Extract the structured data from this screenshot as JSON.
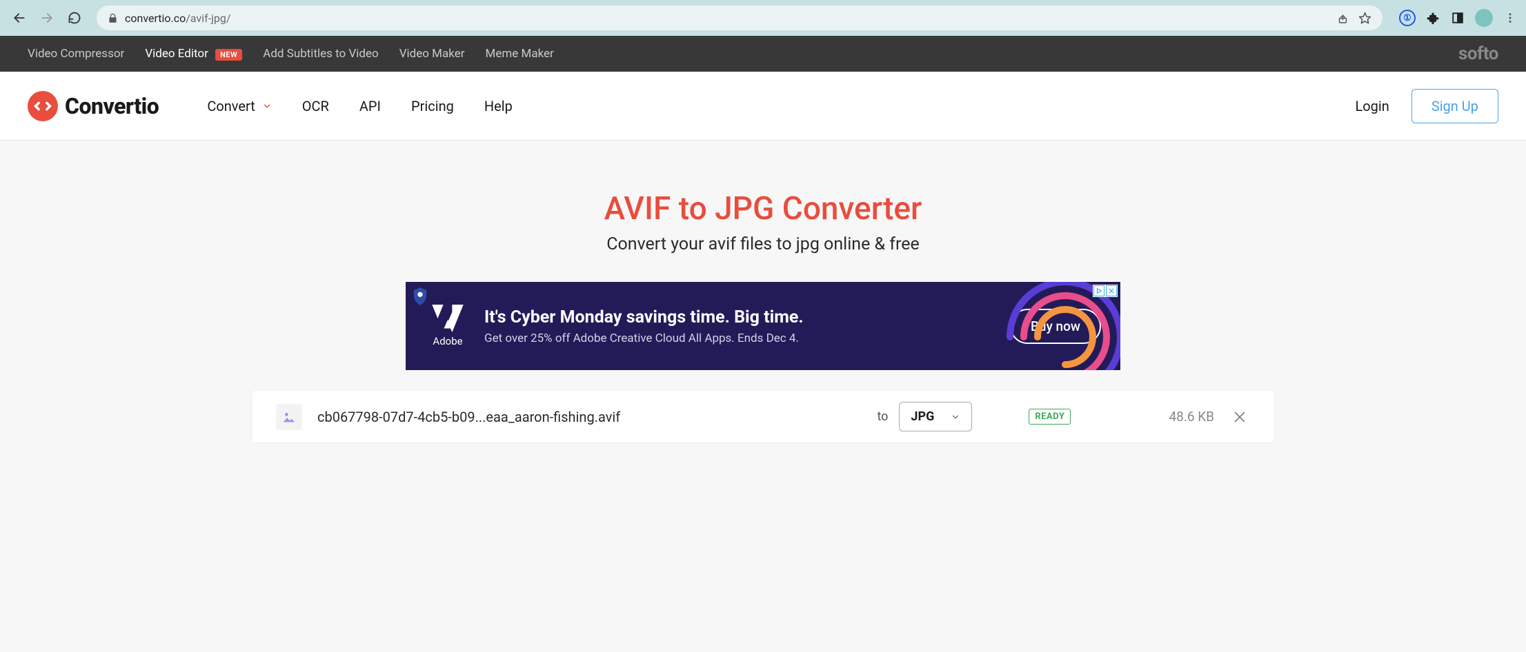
{
  "browser": {
    "url_domain": "convertio.co",
    "url_path": "/avif-jpg/"
  },
  "topbar": {
    "items": [
      {
        "label": "Video Compressor",
        "active": false,
        "badge": ""
      },
      {
        "label": "Video Editor",
        "active": true,
        "badge": "NEW"
      },
      {
        "label": "Add Subtitles to Video",
        "active": false,
        "badge": ""
      },
      {
        "label": "Video Maker",
        "active": false,
        "badge": ""
      },
      {
        "label": "Meme Maker",
        "active": false,
        "badge": ""
      }
    ],
    "brand": "softo"
  },
  "header": {
    "logo_text": "Convertio",
    "nav": {
      "convert": "Convert",
      "ocr": "OCR",
      "api": "API",
      "pricing": "Pricing",
      "help": "Help"
    },
    "login": "Login",
    "signup": "Sign Up"
  },
  "hero": {
    "title": "AVIF to JPG Converter",
    "subtitle": "Convert your avif files to jpg online & free"
  },
  "ad": {
    "brand": "Adobe",
    "headline": "It's Cyber Monday savings time. Big time.",
    "subline": "Get over 25% off Adobe Creative Cloud All Apps. Ends Dec 4.",
    "cta": "Buy now"
  },
  "file": {
    "name": "cb067798-07d7-4cb5-b09...eaa_aaron-fishing.avif",
    "to_label": "to",
    "format": "JPG",
    "status": "READY",
    "size": "48.6 KB"
  }
}
